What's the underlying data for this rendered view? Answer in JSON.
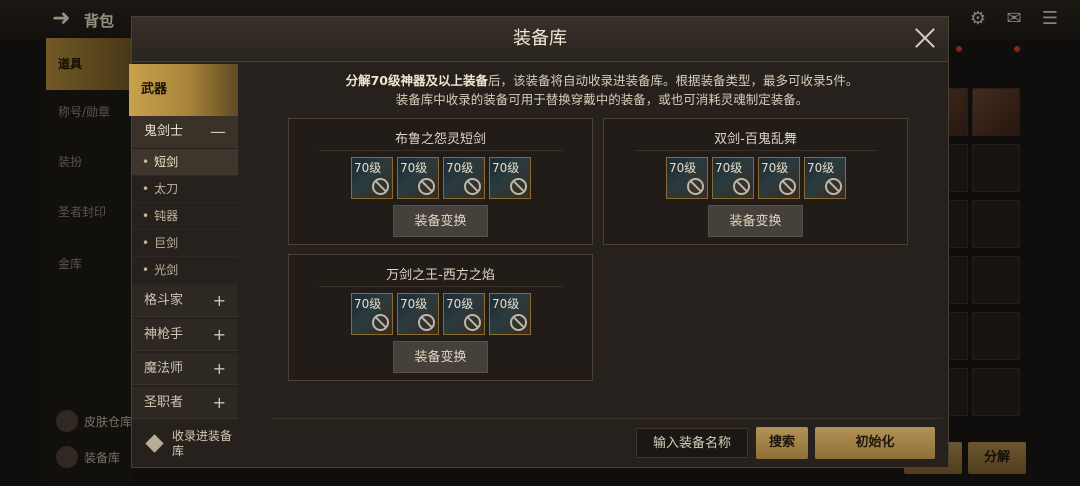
{
  "background": {
    "title": "背包",
    "sidebar": [
      "道具",
      "称号/勋章",
      "装扮",
      "圣者封印",
      "金库"
    ],
    "bottom_items": [
      "皮肤仓库",
      "装备库"
    ],
    "buttons": [
      "",
      "分解"
    ]
  },
  "modal": {
    "title": "装备库",
    "description": {
      "line1_bold": "分解70级神器及以上装备",
      "line1_rest": "后，该装备将自动收录进装备库。根据装备类型，最多可收录5件。",
      "line2": "装备库中收录的装备可用于替换穿戴中的装备，或也可消耗灵魂制定装备。"
    },
    "nav": {
      "category": "武器",
      "classes": [
        {
          "label": "鬼剑士",
          "toggle": "—",
          "expanded": true,
          "subs": [
            "短剑",
            "太刀",
            "钝器",
            "巨剑",
            "光剑"
          ],
          "selected": "短剑"
        },
        {
          "label": "格斗家",
          "toggle": "+"
        },
        {
          "label": "神枪手",
          "toggle": "+"
        },
        {
          "label": "魔法师",
          "toggle": "+"
        },
        {
          "label": "圣职者",
          "toggle": "+"
        }
      ]
    },
    "cards": [
      {
        "name": "布鲁之怨灵短剑",
        "slots": [
          "70级",
          "70级",
          "70级",
          "70级"
        ],
        "button": "装备变换"
      },
      {
        "name": "双剑-百鬼乱舞",
        "slots": [
          "70级",
          "70级",
          "70级",
          "70级"
        ],
        "button": "装备变换"
      },
      {
        "name": "万剑之王-西方之焰",
        "slots": [
          "70级",
          "70级",
          "70级",
          "70级"
        ],
        "button": "装备变换"
      }
    ],
    "footer": {
      "collect_label": "收录进装备库",
      "search_placeholder": "输入装备名称",
      "search_button": "搜索",
      "reset_button": "初始化"
    }
  }
}
